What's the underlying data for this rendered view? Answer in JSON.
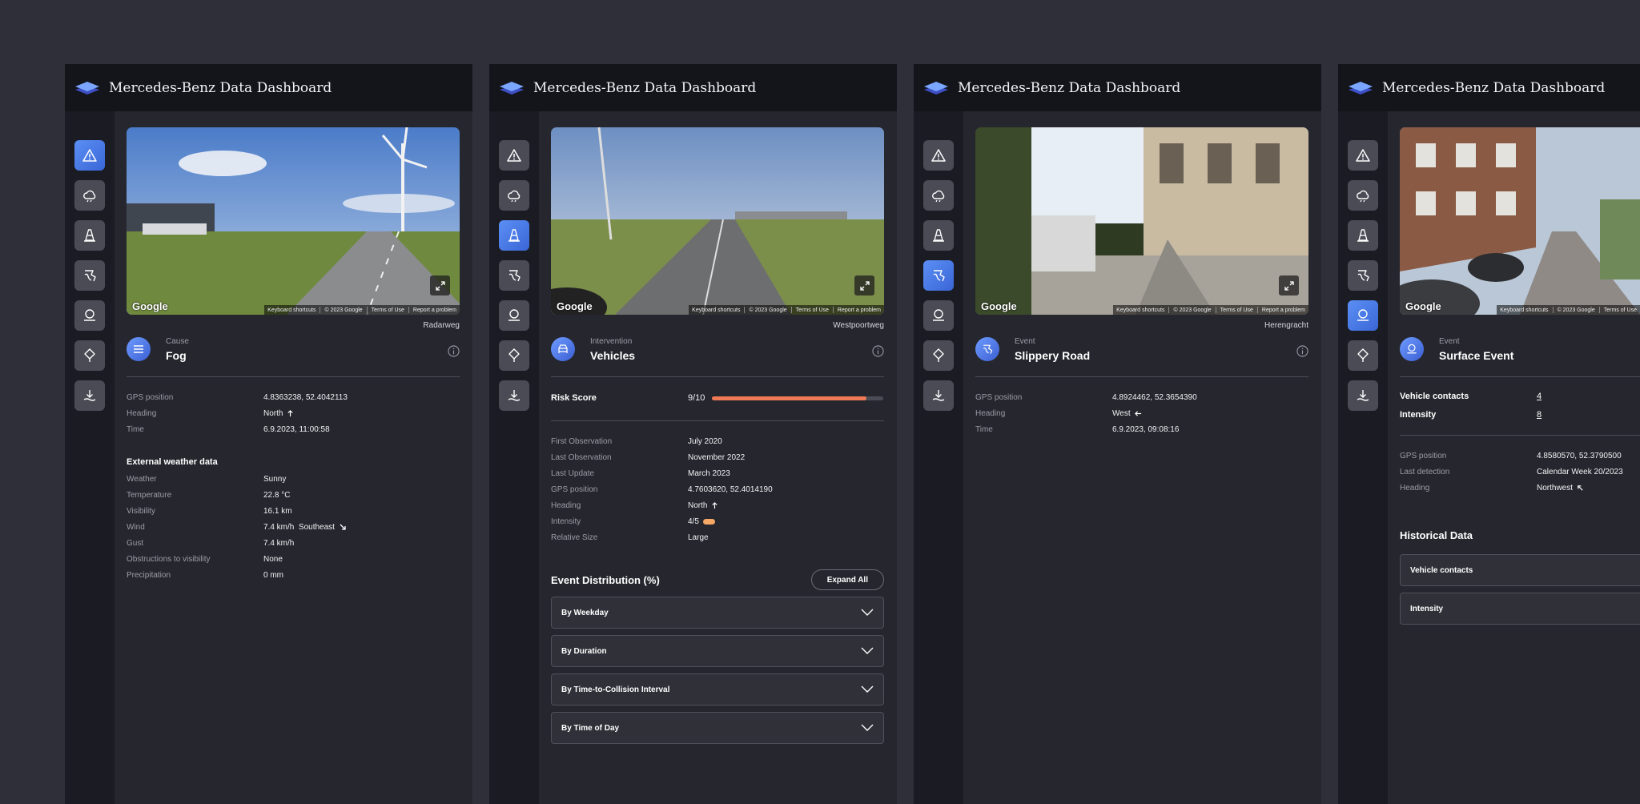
{
  "app_title": "Mercedes-Benz Data Dashboard",
  "photo": {
    "google_label": "Google",
    "attribution": [
      "Keyboard shortcuts",
      "© 2023 Google",
      "Terms of Use",
      "Report a problem"
    ]
  },
  "sidebar_icons": [
    "warning-icon",
    "weather-cloud-icon",
    "traffic-cone-icon",
    "slippery-road-icon",
    "surface-event-icon",
    "location-pin-icon",
    "download-icon"
  ],
  "panels": [
    {
      "street": "Radarweg",
      "category": "Cause",
      "event": "Fog",
      "event_icon": "fog-icon",
      "active_sidebar": "warning-icon",
      "details": [
        {
          "key": "GPS position",
          "value": "4.8363238, 52.4042113"
        },
        {
          "key": "Heading",
          "value": "North",
          "arrow": "north-arrow-icon"
        },
        {
          "key": "Time",
          "value": "6.9.2023, 11:00:58"
        }
      ],
      "weather_title": "External weather data",
      "weather": [
        {
          "key": "Weather",
          "value": "Sunny"
        },
        {
          "key": "Temperature",
          "value": "22.8 °C"
        },
        {
          "key": "Visibility",
          "value": "16.1 km"
        },
        {
          "key": "Wind",
          "value": "7.4 km/h  Southeast",
          "arrow": "southeast-arrow-icon"
        },
        {
          "key": "Gust",
          "value": "7.4 km/h"
        },
        {
          "key": "Obstructions to visibility",
          "value": "None"
        },
        {
          "key": "Precipitation",
          "value": "0 mm"
        }
      ]
    },
    {
      "street": "Westpoortweg",
      "category": "Intervention",
      "event": "Vehicles",
      "event_icon": "car-icon",
      "active_sidebar": "traffic-cone-icon",
      "risk": {
        "label": "Risk Score",
        "value": "9/10",
        "fraction": 0.9
      },
      "details": [
        {
          "key": "First Observation",
          "value": "July 2020"
        },
        {
          "key": "Last Observation",
          "value": "November 2022"
        },
        {
          "key": "Last Update",
          "value": "March 2023"
        },
        {
          "key": "GPS position",
          "value": "4.7603620, 52.4014190"
        },
        {
          "key": "Heading",
          "value": "North",
          "arrow": "north-arrow-icon"
        },
        {
          "key": "Intensity",
          "value": "4/5",
          "pill": true
        },
        {
          "key": "Relative Size",
          "value": "Large"
        }
      ],
      "distribution_title": "Event Distribution (%)",
      "expand_all": "Expand All",
      "accordions": [
        "By Weekday",
        "By Duration",
        "By Time-to-Collision Interval",
        "By Time of Day"
      ]
    },
    {
      "street": "Herengracht",
      "category": "Event",
      "event": "Slippery Road",
      "event_icon": "slippery-road-icon",
      "active_sidebar": "slippery-road-icon",
      "details": [
        {
          "key": "GPS position",
          "value": "4.8924462, 52.3654390"
        },
        {
          "key": "Heading",
          "value": "West",
          "arrow": "west-arrow-icon"
        },
        {
          "key": "Time",
          "value": "6.9.2023, 09:08:16"
        }
      ]
    },
    {
      "category": "Event",
      "event": "Surface Event",
      "event_icon": "surface-event-icon",
      "active_sidebar": "surface-event-icon",
      "counts": [
        {
          "key": "Vehicle contacts",
          "value": "4"
        },
        {
          "key": "Intensity",
          "value": "8"
        }
      ],
      "details": [
        {
          "key": "GPS position",
          "value": "4.8580570, 52.3790500"
        },
        {
          "key": "Last detection",
          "value": "Calendar Week 20/2023"
        },
        {
          "key": "Heading",
          "value": "Northwest",
          "arrow": "northwest-arrow-icon"
        }
      ],
      "history_title": "Historical Data",
      "history": [
        "Vehicle contacts",
        "Intensity"
      ]
    }
  ]
}
